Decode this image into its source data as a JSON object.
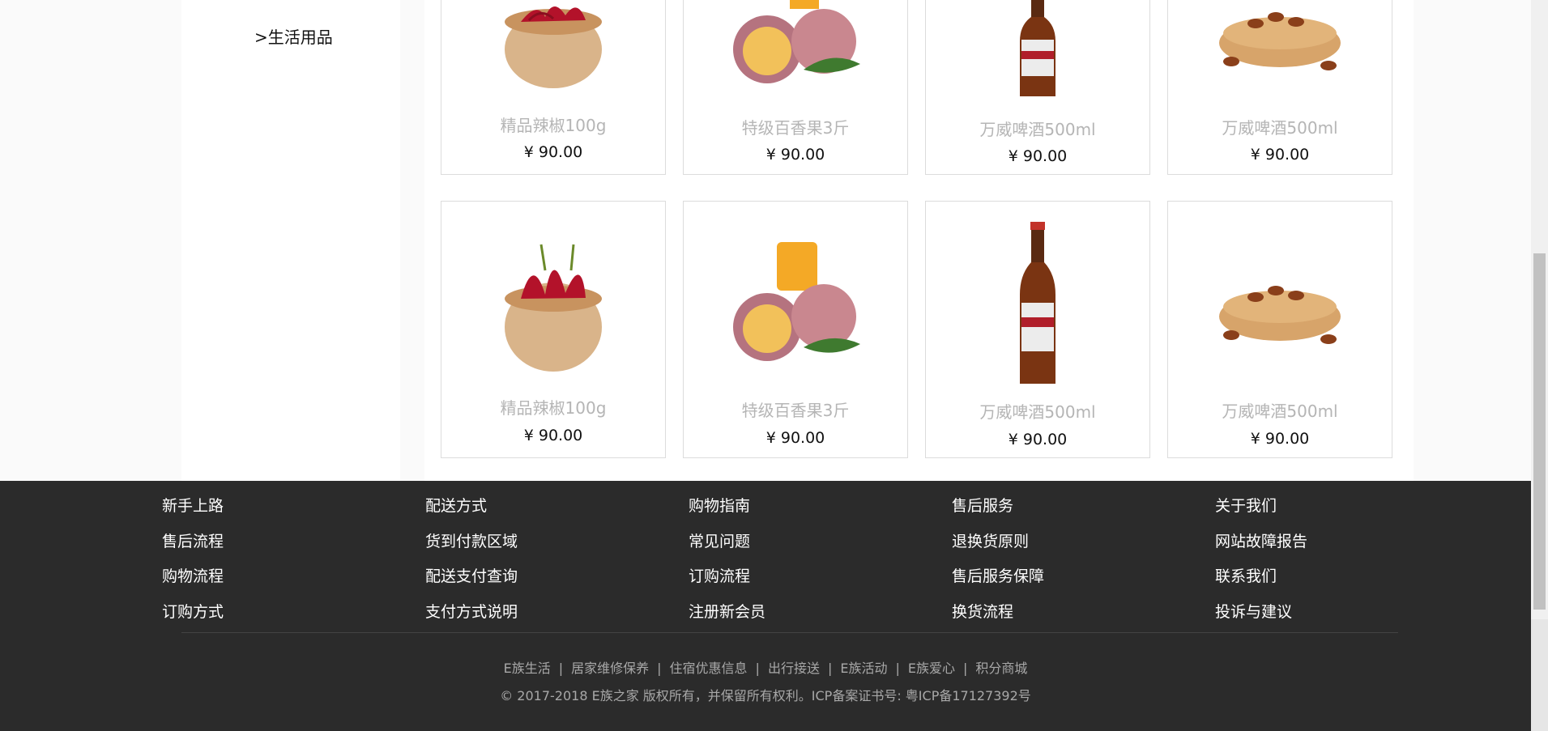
{
  "sidebar": {
    "current_item": ">生活用品"
  },
  "products": [
    {
      "name": "精品辣椒100g",
      "price": "¥ 90.00",
      "image": "chili-bowl"
    },
    {
      "name": "特级百香果3斤",
      "price": "¥ 90.00",
      "image": "passion-fruit"
    },
    {
      "name": "万威啤酒500ml",
      "price": "¥ 90.00",
      "image": "beer-bottle"
    },
    {
      "name": "万威啤酒500ml",
      "price": "¥ 90.00",
      "image": "pine-nuts-bowl"
    },
    {
      "name": "精品辣椒100g",
      "price": "¥ 90.00",
      "image": "chili-bowl"
    },
    {
      "name": "特级百香果3斤",
      "price": "¥ 90.00",
      "image": "passion-fruit"
    },
    {
      "name": "万威啤酒500ml",
      "price": "¥ 90.00",
      "image": "beer-bottle"
    },
    {
      "name": "万威啤酒500ml",
      "price": "¥ 90.00",
      "image": "pine-nuts-bowl"
    }
  ],
  "footer": {
    "columns": [
      {
        "items": [
          "新手上路",
          "售后流程",
          "购物流程",
          "订购方式"
        ]
      },
      {
        "items": [
          "配送方式",
          "货到付款区域",
          "配送支付查询",
          "支付方式说明"
        ]
      },
      {
        "items": [
          "购物指南",
          "常见问题",
          "订购流程",
          "注册新会员"
        ]
      },
      {
        "items": [
          "售后服务",
          "退换货原则",
          "售后服务保障",
          "换货流程"
        ]
      },
      {
        "items": [
          "关于我们",
          "网站故障报告",
          "联系我们",
          "投诉与建议"
        ]
      }
    ],
    "links": [
      "E族生活",
      "居家维修保养",
      "住宿优惠信息",
      "出行接送",
      "E族活动",
      "E族爱心",
      "积分商城"
    ],
    "separator": "|",
    "copyright": "© 2017-2018 E族之家 版权所有，并保留所有权利。ICP备案证书号: 粤ICP备17127392号"
  }
}
